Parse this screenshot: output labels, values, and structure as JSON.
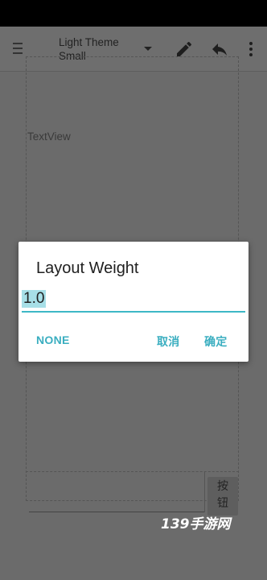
{
  "toolbar": {
    "theme_line1": "Light Theme",
    "theme_line2": "Small",
    "icons": [
      "menu-icon",
      "dropdown-icon",
      "pencil-icon",
      "undo-icon",
      "more-vert-icon"
    ]
  },
  "canvas": {
    "textview_label": "TextView",
    "button_label_1": "按",
    "button_label_2": "钮"
  },
  "dialog": {
    "title": "Layout Weight",
    "input_value": "1.0",
    "none_label": "NONE",
    "cancel_label": "取消",
    "ok_label": "确定"
  },
  "watermark": "139手游网",
  "colors": {
    "accent": "#3db8c6",
    "selection": "#a7dfe7",
    "scrim": "#6b6b6b"
  }
}
